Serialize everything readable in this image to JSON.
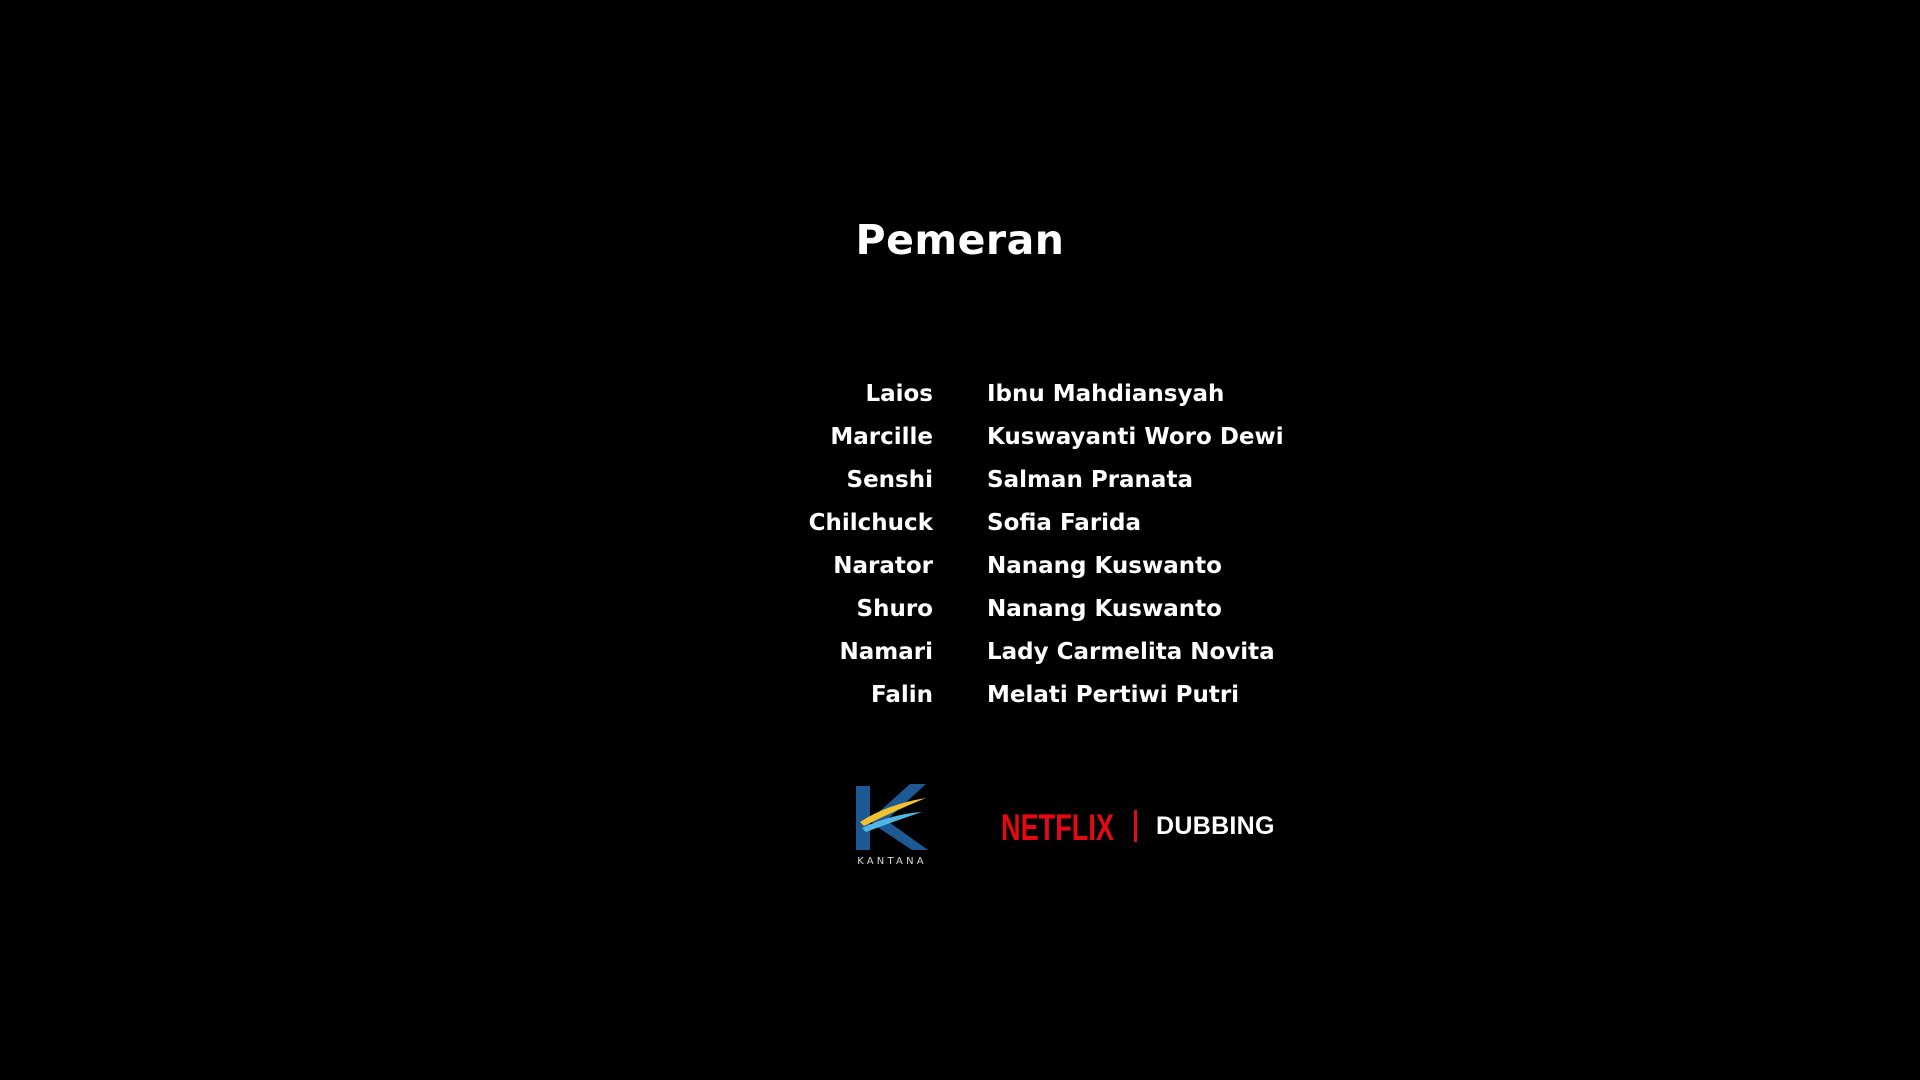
{
  "section_title": "Pemeran",
  "cast": [
    {
      "role": "Laios",
      "actor": "Ibnu Mahdiansyah"
    },
    {
      "role": "Marcille",
      "actor": "Kuswayanti Woro Dewi"
    },
    {
      "role": "Senshi",
      "actor": "Salman Pranata"
    },
    {
      "role": "Chilchuck",
      "actor": "Sofia Farida"
    },
    {
      "role": "Narator",
      "actor": "Nanang Kuswanto"
    },
    {
      "role": "Shuro",
      "actor": "Nanang Kuswanto"
    },
    {
      "role": "Namari",
      "actor": "Lady Carmelita Novita"
    },
    {
      "role": "Falin",
      "actor": "Melati Pertiwi Putri"
    }
  ],
  "logos": {
    "kantana": {
      "text": "KANTANA",
      "icon": "kantana-logo-icon"
    },
    "netflix": {
      "text": "NETFLIX",
      "icon": "netflix-logo-icon"
    },
    "dubbing_label": "DUBBING"
  },
  "colors": {
    "background": "#000000",
    "text": "#ffffff",
    "netflix_red": "#e50914",
    "kantana_blue": "#1d5a93"
  }
}
